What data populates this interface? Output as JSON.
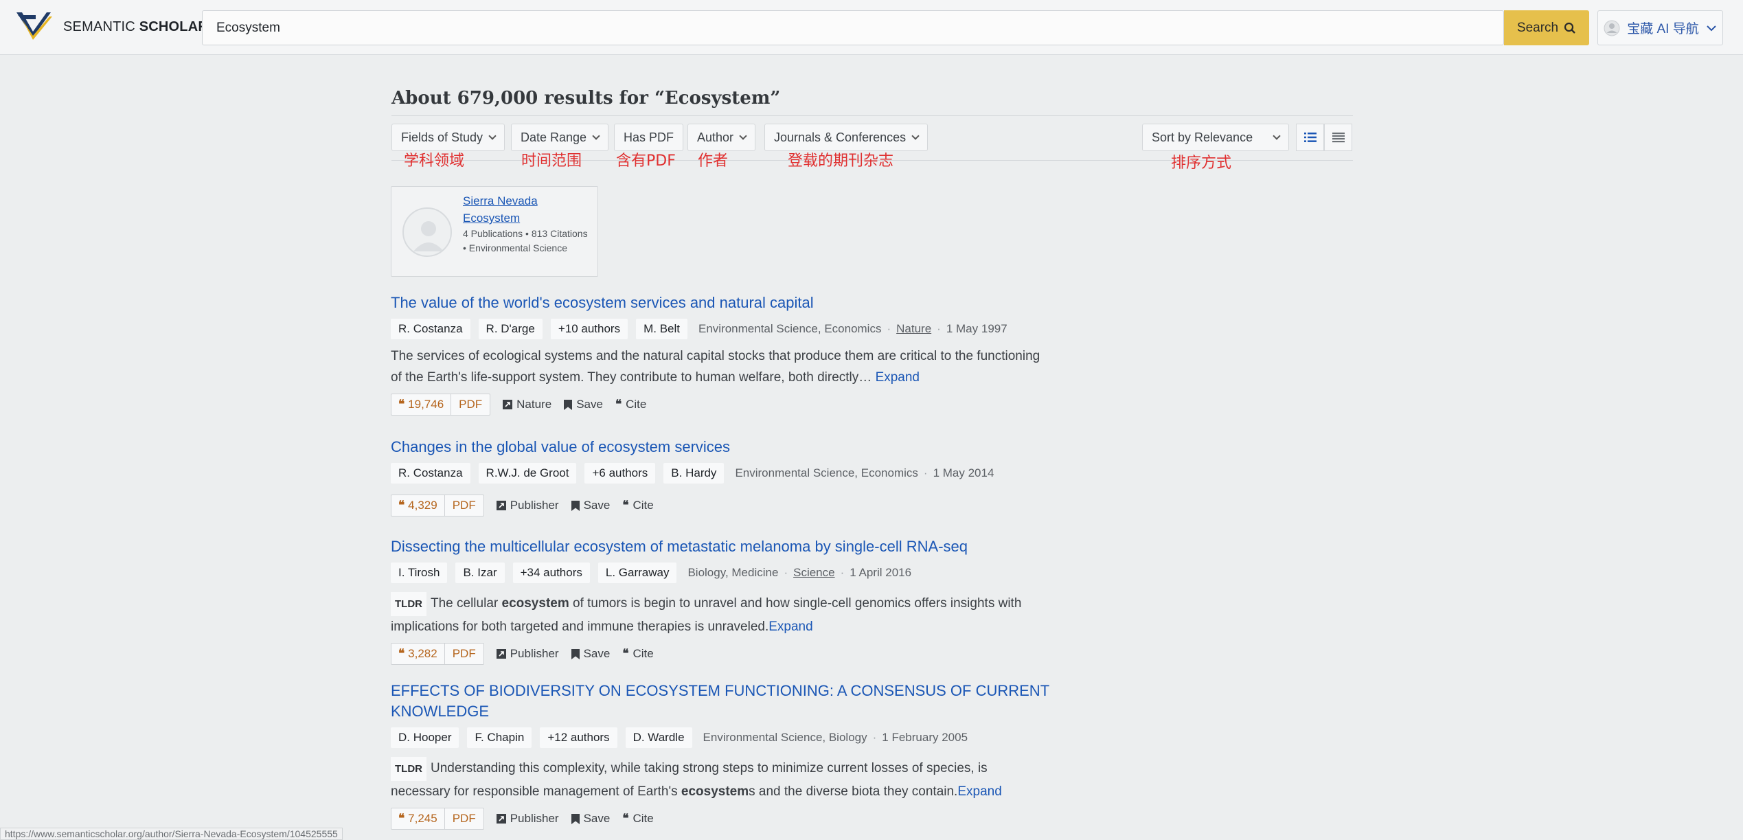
{
  "header": {
    "logo_text_regular": "SEMANTIC",
    "logo_text_bold": "SCHOLAR",
    "search_value": "Ecosystem",
    "search_button": "Search",
    "ai_nav_label": "宝藏 AI 导航"
  },
  "results": {
    "title": "About 679,000 results for “Ecosystem”"
  },
  "filters": {
    "fields_of_study": "Fields of Study",
    "date_range": "Date Range",
    "has_pdf": "Has PDF",
    "author": "Author",
    "journals": "Journals & Conferences",
    "sort": "Sort by Relevance"
  },
  "annotations": {
    "fields_of_study": "学科领域",
    "date_range": "时间范围",
    "has_pdf": "含有PDF",
    "author": "作者",
    "journals": "登载的期刊杂志",
    "sort": "排序方式"
  },
  "entity": {
    "name": "Sierra Nevada Ecosystem",
    "meta": "4 Publications • 813 Citations • Environmental Science"
  },
  "papers": [
    {
      "title": "The value of the world's ecosystem services and natural capital",
      "authors": [
        "R. Costanza",
        "R. D'arge",
        "+10 authors",
        "M. Belt"
      ],
      "fields": "Environmental Science, Economics",
      "venue": "Nature",
      "date": "1 May 1997",
      "abstract": "The services of ecological systems and the natural capital stocks that produce them are critical to the functioning of the Earth's life-support system. They contribute to human welfare, both directly…",
      "expand": "Expand",
      "citations": "19,746",
      "pdf": "PDF",
      "source": "Nature",
      "save": "Save",
      "cite": "Cite"
    },
    {
      "title": "Changes in the global value of ecosystem services",
      "authors": [
        "R. Costanza",
        "R.W.J. de Groot",
        "+6 authors",
        "B. Hardy"
      ],
      "fields": "Environmental Science, Economics",
      "date": "1 May 2014",
      "citations": "4,329",
      "pdf": "PDF",
      "source": "Publisher",
      "save": "Save",
      "cite": "Cite"
    },
    {
      "title": "Dissecting the multicellular ecosystem of metastatic melanoma by single-cell RNA-seq",
      "authors": [
        "I. Tirosh",
        "B. Izar",
        "+34 authors",
        "L. Garraway"
      ],
      "fields": "Biology, Medicine",
      "venue": "Science",
      "date": "1 April 2016",
      "tldr_label": "TLDR",
      "abstract_pre": "The cellular ",
      "abstract_bold": "ecosystem",
      "abstract_post": " of tumors is begin to unravel and how single-cell genomics offers insights with implications for both targeted and immune therapies is unraveled.",
      "expand": "Expand",
      "citations": "3,282",
      "pdf": "PDF",
      "source": "Publisher",
      "save": "Save",
      "cite": "Cite"
    },
    {
      "title": "EFFECTS OF BIODIVERSITY ON ECOSYSTEM FUNCTIONING: A CONSENSUS OF CURRENT KNOWLEDGE",
      "authors": [
        "D. Hooper",
        "F. Chapin",
        "+12 authors",
        "D. Wardle"
      ],
      "fields": "Environmental Science, Biology",
      "date": "1 February 2005",
      "tldr_label": "TLDR",
      "abstract_pre": "Understanding this complexity, while taking strong steps to minimize current losses of species, is necessary for responsible management of Earth's ",
      "abstract_bold": "ecosystem",
      "abstract_post": "s and the diverse biota they contain.",
      "expand": "Expand",
      "citations": "7,245",
      "pdf": "PDF",
      "source": "Publisher",
      "save": "Save",
      "cite": "Cite"
    }
  ],
  "status_bar": {
    "url": "https://www.semanticscholar.org/author/Sierra-Nevada-Ecosystem/104525555"
  },
  "colors": {
    "link": "#1a56b5",
    "search_button": "#e6c04c",
    "citation": "#b5651d",
    "annotation": "#e03030"
  }
}
